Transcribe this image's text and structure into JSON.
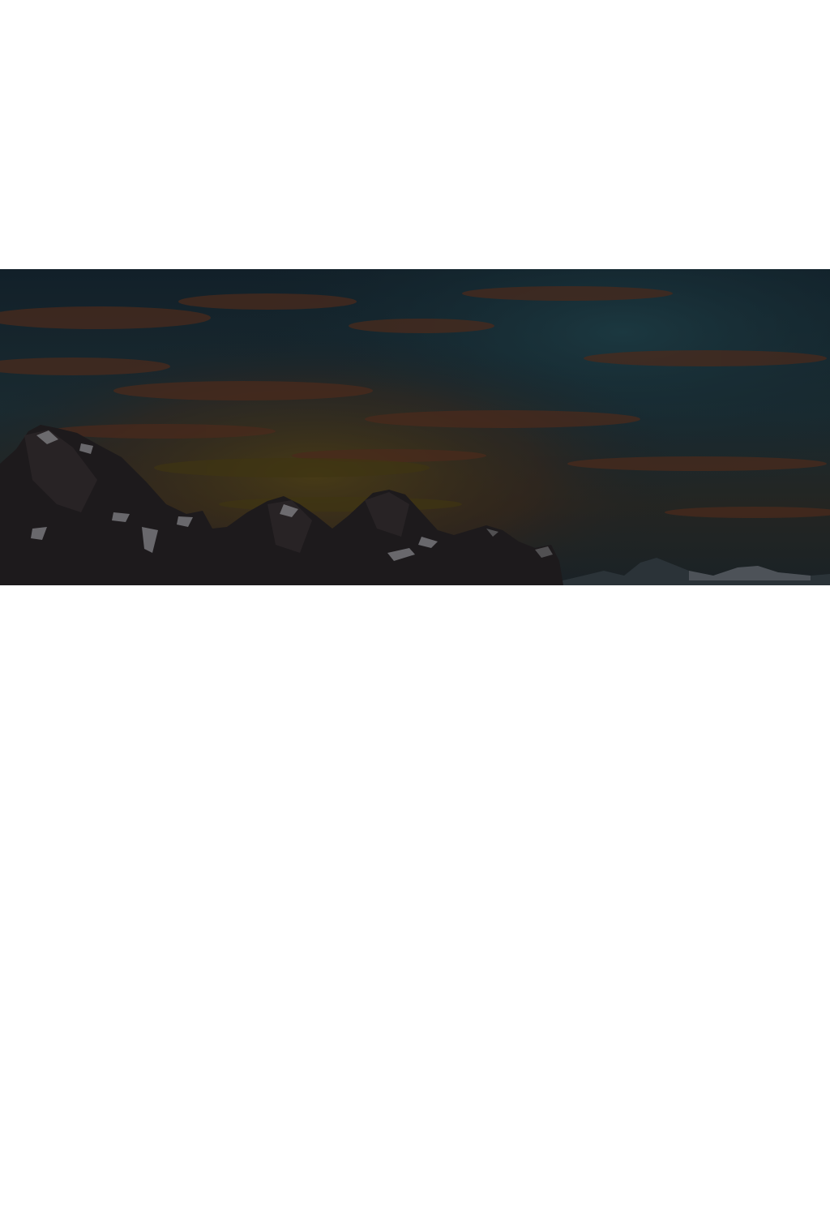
{
  "page": {
    "background_color": "#ffffff"
  },
  "hero": {
    "image": "night-mountain-landscape",
    "colors": {
      "sky_dark": "#0f1e26",
      "sky_teal": "#18323a",
      "cloud_orange": "#4a2a1c",
      "horizon_amber": "#3d3415",
      "rock": "#1d1a1b",
      "snow": "#8a8a8e"
    }
  }
}
